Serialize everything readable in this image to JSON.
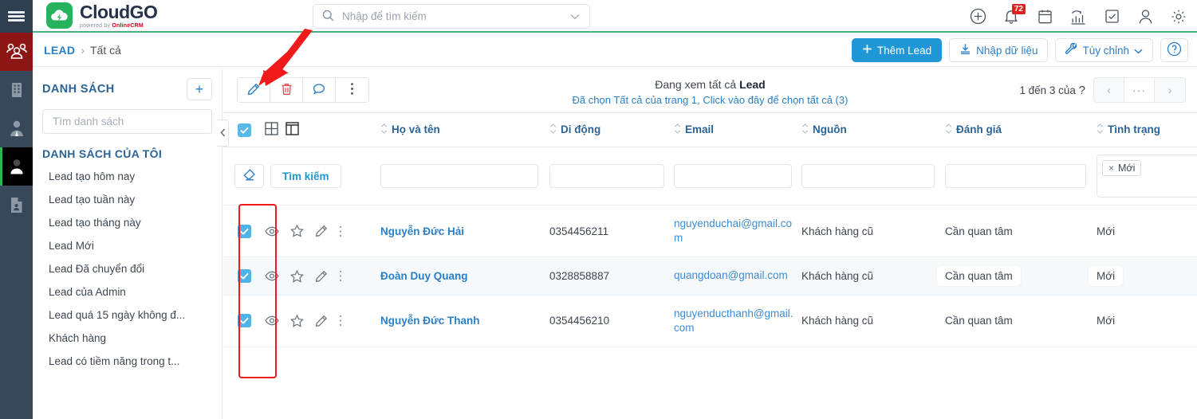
{
  "brand": {
    "name": "CloudGO",
    "tagline_pre": "powered by",
    "tagline_brand": "OnlineCRM"
  },
  "search": {
    "placeholder": "Nhập để tìm kiếm",
    "value": ""
  },
  "topbar_icons": [
    {
      "name": "add-circle-icon",
      "label": "Thêm mới"
    },
    {
      "name": "bell-icon",
      "label": "Thông báo",
      "badge": "72"
    },
    {
      "name": "calendar-icon",
      "label": "Lịch"
    },
    {
      "name": "chart-icon",
      "label": "Báo cáo"
    },
    {
      "name": "task-check-icon",
      "label": "Công việc"
    },
    {
      "name": "user-icon",
      "label": "Tài khoản"
    },
    {
      "name": "gear-icon",
      "label": "Cài đặt"
    }
  ],
  "rail": [
    {
      "name": "menu-burger-icon",
      "label": "Menu"
    },
    {
      "name": "customers-group-icon",
      "label": "Khách hàng",
      "state": "active-red"
    },
    {
      "name": "company-building-icon",
      "label": "Công ty"
    },
    {
      "name": "contact-person-icon",
      "label": "Liên hệ"
    },
    {
      "name": "lead-person-icon",
      "label": "Lead",
      "state": "active-black"
    },
    {
      "name": "document-person-icon",
      "label": "Hồ sơ"
    }
  ],
  "breadcrumb": {
    "root": "LEAD",
    "separator": "›",
    "current": "Tất cả"
  },
  "crumb_actions": {
    "add_lead": "Thêm Lead",
    "import": "Nhập dữ liệu",
    "customize": "Tùy chỉnh",
    "help": "?"
  },
  "sidebar": {
    "title": "DANH SÁCH",
    "add_label": "+",
    "search_placeholder": "Tìm danh sách",
    "search_value": "",
    "section_title": "DANH SÁCH CỦA TÔI",
    "items": [
      {
        "label": "Lead tạo hôm nay"
      },
      {
        "label": "Lead tạo tuần này"
      },
      {
        "label": "Lead tạo tháng này"
      },
      {
        "label": "Lead Mới"
      },
      {
        "label": "Lead Đã chuyển đổi"
      },
      {
        "label": "Lead của Admin"
      },
      {
        "label": "Lead quá 15 ngày không đ..."
      },
      {
        "label": "Khách hàng"
      },
      {
        "label": "Lead có tiềm năng trong t..."
      }
    ]
  },
  "actionbar": {
    "buttons": [
      {
        "name": "edit-pencil-icon",
        "label": "Sửa"
      },
      {
        "name": "delete-trash-icon",
        "label": "Xóa"
      },
      {
        "name": "comment-bubble-icon",
        "label": "Bình luận"
      },
      {
        "name": "more-vertical-icon",
        "label": "Thêm"
      }
    ],
    "view_title_prefix": "Đang xem tất cả ",
    "view_title_entity": "Lead",
    "select_all_link": "Đã chọn Tất cả của trang 1, Click vào đây để chọn tất cả (3)",
    "pager": {
      "count_text": "1 đến 3 của ",
      "count_unknown": "?",
      "prev": "‹",
      "more": "···",
      "next": "›"
    }
  },
  "table": {
    "header_icons": [
      {
        "name": "grid-view-icon",
        "label": "Xem dạng lưới"
      },
      {
        "name": "column-view-icon",
        "label": "Xem dạng cột"
      }
    ],
    "columns": [
      {
        "key": "name",
        "label": "Họ và tên"
      },
      {
        "key": "phone",
        "label": "Di động"
      },
      {
        "key": "email",
        "label": "Email"
      },
      {
        "key": "source",
        "label": "Nguồn"
      },
      {
        "key": "rating",
        "label": "Đánh giá"
      },
      {
        "key": "status",
        "label": "Tình trạng"
      }
    ],
    "filter": {
      "clear_label": "clear-filter",
      "search_label": "Tìm kiếm",
      "name_value": "",
      "phone_value": "",
      "email_value": "",
      "source_value": "",
      "rating_value": "",
      "status_tags": [
        {
          "label": "Mới",
          "remove": "×"
        }
      ]
    },
    "row_icons": [
      {
        "name": "eye-preview-icon",
        "label": "Xem nhanh"
      },
      {
        "name": "star-favorite-icon",
        "label": "Đánh dấu"
      },
      {
        "name": "edit-pencil-icon",
        "label": "Sửa"
      },
      {
        "name": "more-vertical-icon",
        "label": "Thêm"
      }
    ],
    "rows": [
      {
        "checked": true,
        "name": "Nguyễn Đức Hải",
        "phone": "0354456211",
        "email": "nguyenduchai@gmail.com",
        "source": "Khách hàng cũ",
        "rating": "Cần quan tâm",
        "status": "Mới",
        "hover": false
      },
      {
        "checked": true,
        "name": "Đoàn Duy Quang",
        "phone": "0328858887",
        "email": "quangdoan@gmail.com",
        "source": "Khách hàng cũ",
        "rating": "Cần quan tâm",
        "status": "Mới",
        "hover": true
      },
      {
        "checked": true,
        "name": "Nguyễn Đức Thanh",
        "phone": "0354456210",
        "email": "nguyenducthanh@gmail.com",
        "source": "Khách hàng cũ",
        "rating": "Cần quan tâm",
        "status": "Mới",
        "hover": false
      }
    ]
  },
  "colors": {
    "brand_green": "#25b35e",
    "accent_blue": "#2196d4",
    "link_blue": "#2a7fc9",
    "annotation_red": "#f01a1a",
    "badge_red": "#e02020",
    "rail_dark": "#36485a",
    "rail_active_red": "#8c1515"
  }
}
